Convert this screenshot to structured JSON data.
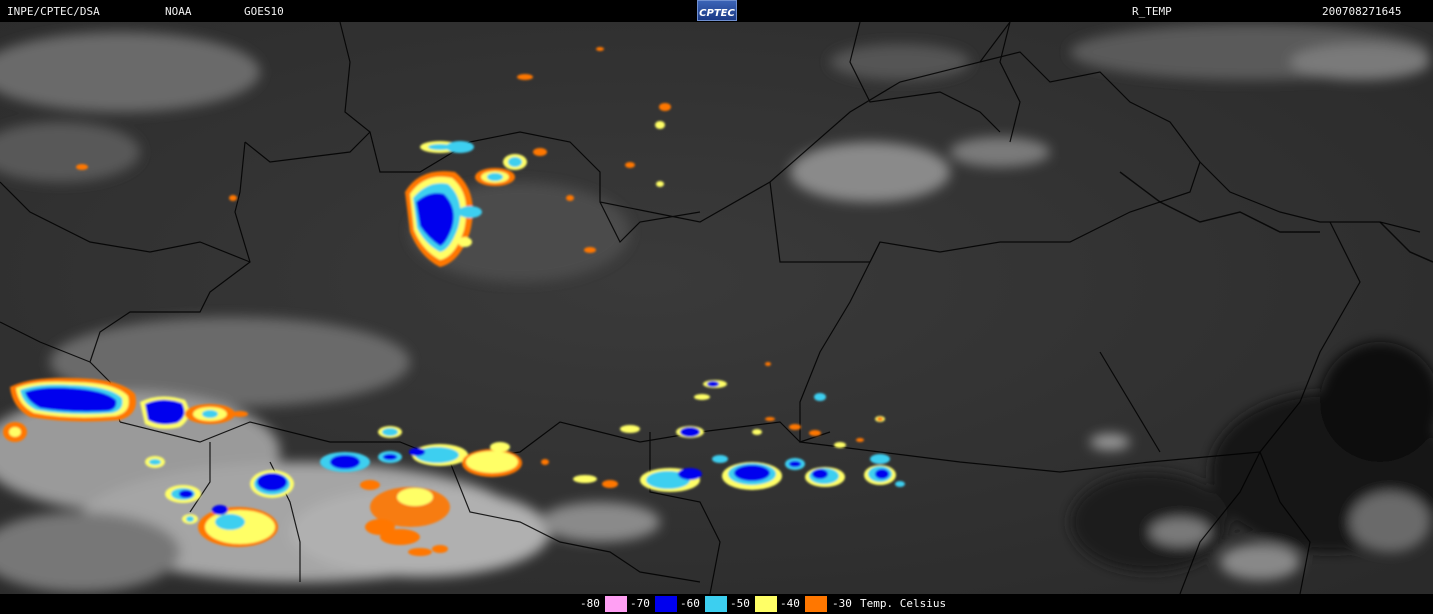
{
  "header": {
    "institution": "INPE/CPTEC/DSA",
    "agency": "NOAA",
    "satellite": "GOES10",
    "logo_text": "CPTEC",
    "product": "R_TEMP",
    "datetime": "200708271645"
  },
  "legend": {
    "entries": [
      {
        "label": "-80",
        "color": "#ff9ff3"
      },
      {
        "label": "-70",
        "color": "#0000ee"
      },
      {
        "label": "-60",
        "color": "#3ccff0"
      },
      {
        "label": "-50",
        "color": "#ffff66"
      },
      {
        "label": "-40",
        "color": "#ff7700"
      },
      {
        "label": "-30",
        "color": null
      }
    ],
    "unit": "Temp. Celsius"
  },
  "colors": {
    "background": "#000000",
    "map_dark": "#2d2d2d",
    "cloud_white": "#c8c8c8",
    "border": "#000000"
  }
}
